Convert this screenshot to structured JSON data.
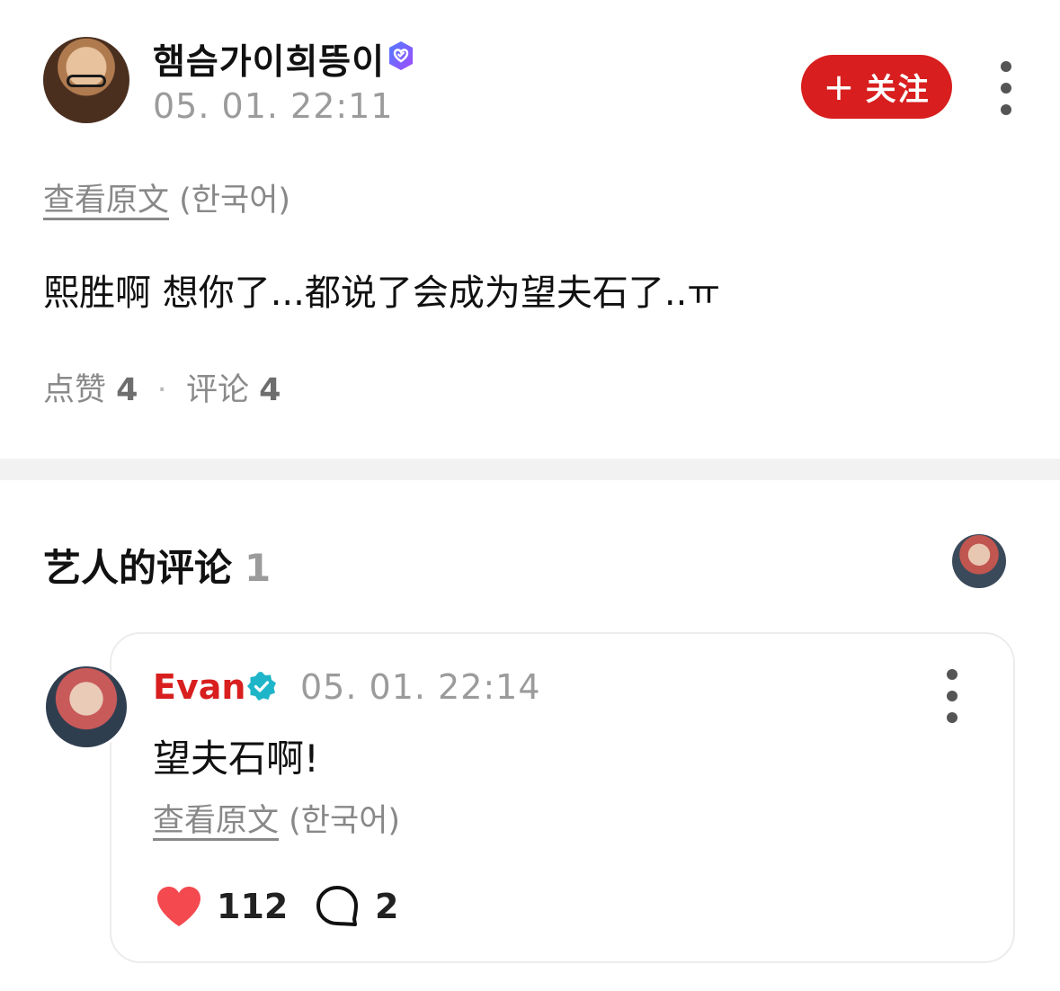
{
  "post": {
    "author_name": "햄슴가이희뜽이",
    "time": "05. 01. 22:11",
    "follow_label": "关注",
    "follow_icon": "plus-icon",
    "verified_icon": "verified-heart-badge-icon",
    "translate_link": "查看原文",
    "translate_lang": "(한국어)",
    "body": "熙胜啊 想你了...都说了会成为望夫石了..ㅠ",
    "likes_label": "点赞",
    "likes_count": "4",
    "comments_label": "评论",
    "comments_count": "4"
  },
  "artist_comments": {
    "title": "艺人的评论",
    "count": "1"
  },
  "comment": {
    "author_name": "Evan",
    "time": "05. 01. 22:14",
    "text": "望夫石啊!",
    "translate_link": "查看原文",
    "translate_lang": "(한국어)",
    "like_count": "112",
    "reply_count": "2"
  },
  "colors": {
    "accent_red": "#d81e1e",
    "verified_teal": "#1fb5c9",
    "muted_text": "#9b9b9b"
  }
}
